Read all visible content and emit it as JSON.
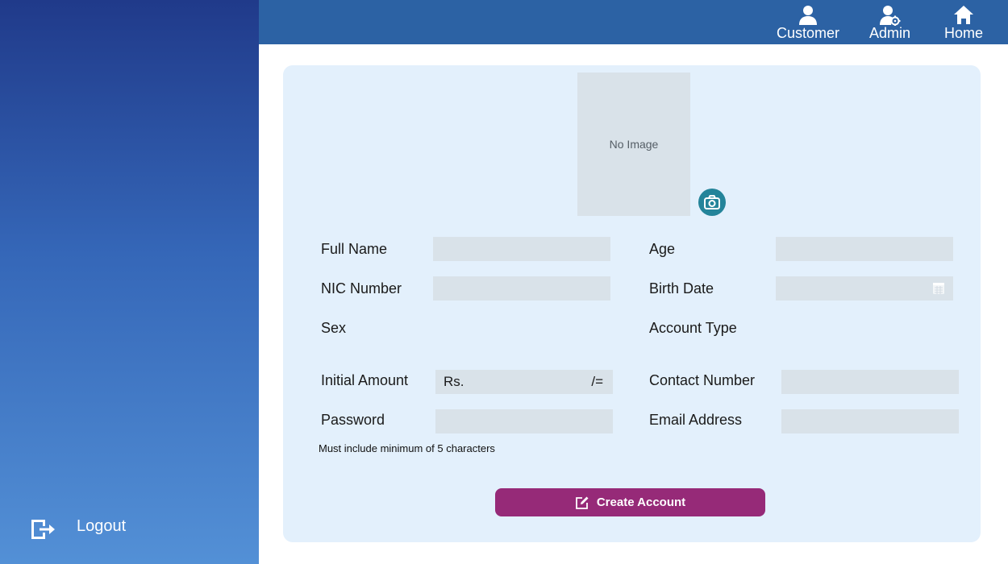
{
  "sidebar": {
    "logout_label": "Logout"
  },
  "nav": {
    "customer": "Customer",
    "admin": "Admin",
    "home": "Home"
  },
  "photo": {
    "placeholder": "No Image"
  },
  "form": {
    "full_name_label": "Full Name",
    "age_label": "Age",
    "nic_label": "NIC Number",
    "birth_date_label": "Birth Date",
    "sex_label": "Sex",
    "account_type_label": "Account Type",
    "initial_amount_label": "Initial Amount",
    "amount_prefix": "Rs.",
    "amount_suffix": "/=",
    "contact_label": "Contact Number",
    "password_label": "Password",
    "email_label": "Email Address",
    "password_hint": "Must include minimum of 5 characters",
    "create_label": "Create Account"
  },
  "colors": {
    "sidebar_top": "#203a8a",
    "sidebar_bottom": "#5390d6",
    "topbar": "#2c62a4",
    "card": "#e3f0fc",
    "field": "#d9e2e9",
    "accent_button": "#962a78",
    "camera_button": "#24849a"
  }
}
